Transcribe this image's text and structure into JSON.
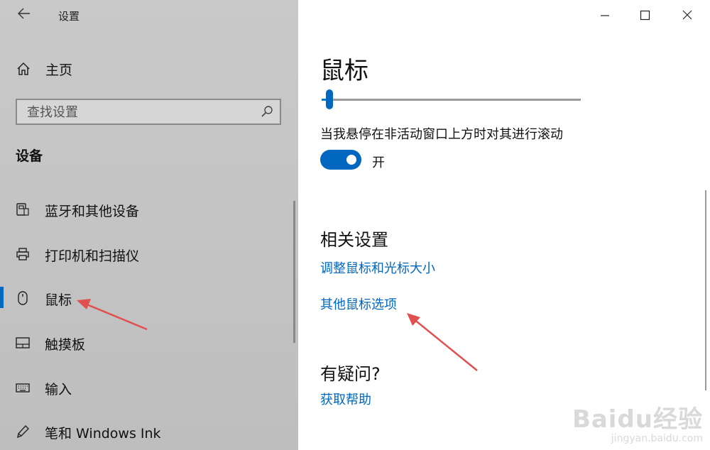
{
  "window": {
    "title": "设置"
  },
  "sidebar": {
    "home_label": "主页",
    "search": {
      "placeholder": "查找设置"
    },
    "section_title": "设备",
    "items": [
      {
        "label": "蓝牙和其他设备",
        "icon": "bluetooth-device-icon"
      },
      {
        "label": "打印机和扫描仪",
        "icon": "printer-icon"
      },
      {
        "label": "鼠标",
        "icon": "mouse-icon",
        "active": true
      },
      {
        "label": "触摸板",
        "icon": "touchpad-icon"
      },
      {
        "label": "输入",
        "icon": "keyboard-icon"
      },
      {
        "label": "笔和 Windows Ink",
        "icon": "pen-icon"
      }
    ]
  },
  "main": {
    "title": "鼠标",
    "slider": {
      "value_fraction": 0.03
    },
    "scroll_inactive": {
      "label": "当我悬停在非活动窗口上方时对其进行滚动",
      "state": "开",
      "on": true
    },
    "related": {
      "title": "相关设置",
      "links": [
        "调整鼠标和光标大小",
        "其他鼠标选项"
      ]
    },
    "help": {
      "title": "有疑问?",
      "link": "获取帮助"
    }
  },
  "watermark": {
    "brand": "Baidu经验",
    "url": "jingyan.baidu.com"
  },
  "colors": {
    "accent": "#0067c0",
    "sidebar_bg": "#c6c6c6",
    "annotation": "#e0504f"
  }
}
